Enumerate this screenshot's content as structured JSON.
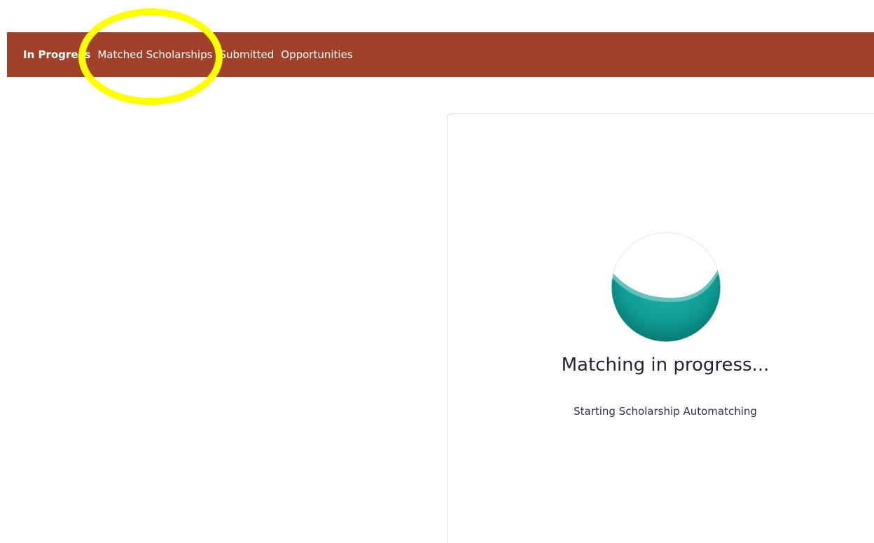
{
  "nav": {
    "items": [
      {
        "label": "In Progress",
        "active": true
      },
      {
        "label": "Matched Scholarships",
        "active": false
      },
      {
        "label": "Submitted",
        "active": false
      },
      {
        "label": "Opportunities",
        "active": false
      }
    ]
  },
  "colors": {
    "nav_background": "#a0412a",
    "highlight": "#ffff00",
    "orb_primary": "#0f9c94",
    "orb_shadow": "#087a73"
  },
  "matching": {
    "icon": "loading-orb-icon",
    "title": "Matching in progress...",
    "status": "Starting Scholarship Automatching"
  }
}
